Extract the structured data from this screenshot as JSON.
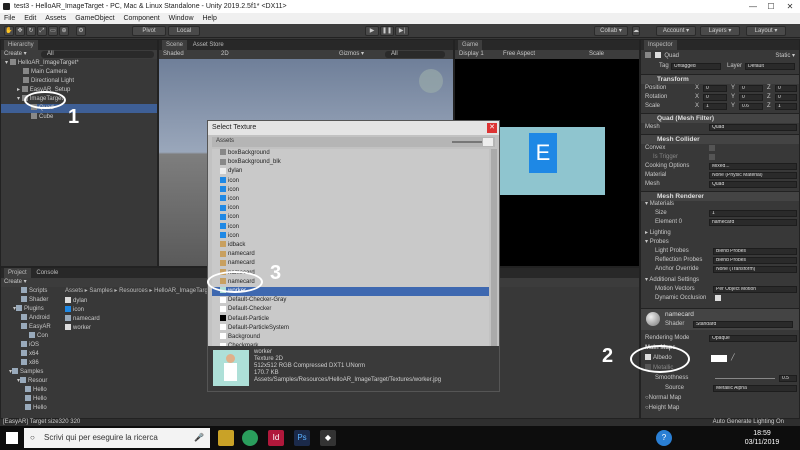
{
  "window": {
    "title": "test3 - HelloAR_ImageTarget - PC, Mac & Linux Standalone - Unity 2019.2.5f1* <DX11>",
    "controls": [
      "—",
      "☐",
      "✕"
    ]
  },
  "menu": [
    "File",
    "Edit",
    "Assets",
    "GameObject",
    "Component",
    "Window",
    "Help"
  ],
  "toolbar": {
    "pivot": "Pivot",
    "local": "Local",
    "collab": "Collab ▾",
    "account": "Account ▾",
    "layers": "Layers ▾",
    "layout": "Layout ▾"
  },
  "hierarchy": {
    "tab": "Hierarchy",
    "create": "Create ▾",
    "search": "All",
    "scene": "HelloAR_ImageTarget*",
    "items": [
      "Main Camera",
      "Directional Light",
      "EasyAR_Setup",
      "ImageTarget",
      "Quad",
      "Cube"
    ]
  },
  "scene": {
    "tab": "Scene",
    "asset_store": "Asset Store",
    "shaded": "Shaded",
    "mode": "2D",
    "gizmos": "Gizmos ▾",
    "search": "All"
  },
  "game": {
    "tab": "Game",
    "display": "Display 1",
    "aspect": "Free Aspect",
    "scale": "Scale",
    "maximize": "Maximize On Play"
  },
  "inspector": {
    "tab": "Inspector",
    "object_name": "Quad",
    "static": "Static ▾",
    "tag_label": "Tag",
    "tag": "Untagged",
    "layer_label": "Layer",
    "layer": "Default",
    "transform": {
      "title": "Transform",
      "position_label": "Position",
      "rotation_label": "Rotation",
      "scale_label": "Scale",
      "position": [
        "0",
        "0",
        "0"
      ],
      "rotation": [
        "0",
        "0",
        "0"
      ],
      "scale": [
        "1",
        "0.6",
        "1"
      ]
    },
    "mesh_filter": {
      "title": "Quad (Mesh Filter)",
      "mesh_label": "Mesh",
      "mesh": "Quad"
    },
    "mesh_collider": {
      "title": "Mesh Collider",
      "convex": "Convex",
      "is_trigger": "Is Trigger",
      "cooking_label": "Cooking Options",
      "cooking": "Mixed...",
      "material_label": "Material",
      "material": "None (Physic Material)",
      "mesh_label": "Mesh",
      "mesh": "Quad"
    },
    "mesh_renderer": {
      "title": "Mesh Renderer",
      "materials": "Materials",
      "size_label": "Size",
      "size": "1",
      "element0_label": "Element 0",
      "element0": "namecard",
      "lighting": "Lighting",
      "probes": "Probes",
      "light_probes_label": "Light Probes",
      "light_probes": "Blend Probes",
      "reflection_label": "Reflection Probes",
      "reflection": "Blend Probes",
      "anchor_label": "Anchor Override",
      "anchor": "None (Transform)",
      "additional": "Additional Settings",
      "motion_label": "Motion Vectors",
      "motion": "Per Object Motion",
      "occlusion_label": "Dynamic Occlusion"
    },
    "material": {
      "name": "namecard",
      "shader_label": "Shader",
      "shader": "Standard",
      "rendering_label": "Rendering Mode",
      "rendering": "Opaque",
      "main_maps": "Main Maps",
      "albedo": "Albedo",
      "metallic": "Metallic",
      "smoothness_label": "Smoothness",
      "smoothness": "0.5",
      "source_label": "Source",
      "source": "Metallic Alpha",
      "normal_map": "Normal Map",
      "height_map": "Height Map"
    }
  },
  "project": {
    "tabs": [
      "Project",
      "Console"
    ],
    "create": "Create ▾",
    "breadcrumb": [
      "Assets",
      "Samples",
      "Resources",
      "HelloAR_ImageTarget"
    ],
    "tree": [
      "Scripts",
      "Shader",
      "Plugins",
      "Android",
      "EasyAR",
      "Con",
      "iOS",
      "x64",
      "x86",
      "Samples",
      "Resour",
      "Hello",
      "Hello",
      "Hello",
      "M",
      "Te"
    ],
    "assets": [
      "dylan",
      "icon",
      "namecard",
      "worker"
    ]
  },
  "dialog": {
    "title": "Select Texture",
    "close": "✕",
    "tab": "Assets",
    "items": [
      {
        "name": "boxBackground",
        "icon": "grey-icon"
      },
      {
        "name": "boxBackground_blk",
        "icon": "grey-icon"
      },
      {
        "name": "dylan",
        "icon": "face-icon"
      },
      {
        "name": "icon",
        "icon": "e-icon"
      },
      {
        "name": "icon",
        "icon": "e-icon"
      },
      {
        "name": "icon",
        "icon": "e-icon"
      },
      {
        "name": "icon",
        "icon": "e-icon"
      },
      {
        "name": "icon",
        "icon": "e-icon"
      },
      {
        "name": "icon",
        "icon": "e-icon"
      },
      {
        "name": "icon",
        "icon": "e-icon"
      },
      {
        "name": "idback",
        "icon": "card-icon"
      },
      {
        "name": "namecard",
        "icon": "card-icon"
      },
      {
        "name": "namecard",
        "icon": "card-icon"
      },
      {
        "name": "namecard",
        "icon": "card-icon"
      },
      {
        "name": "namecard",
        "icon": "card-icon"
      },
      {
        "name": "worker",
        "icon": "worker-icon"
      },
      {
        "name": "Default-Checker-Gray",
        "icon": "white-icon"
      },
      {
        "name": "Default-Checker",
        "icon": "white-icon"
      },
      {
        "name": "Default-Particle",
        "icon": "dot-icon"
      },
      {
        "name": "Default-ParticleSystem",
        "icon": "white-icon"
      },
      {
        "name": "Background",
        "icon": "white-icon"
      },
      {
        "name": "Checkmark",
        "icon": "check-icon"
      },
      {
        "name": "DropdownArrow",
        "icon": "arrow-icon"
      }
    ],
    "selected_index": 15,
    "preview": {
      "name": "worker",
      "type": "Texture 2D",
      "info": "512x512  RGB Compressed DXT1 UNorm",
      "size": "170.7 KB",
      "path": "Assets/Samples/Resources/HelloAR_ImageTarget/Textures/worker.jpg"
    }
  },
  "status_bar": {
    "message": "[EasyAR] Target size320 320",
    "right": "Auto Generate Lighting On"
  },
  "annotations": [
    "1",
    "2",
    "3"
  ],
  "taskbar": {
    "search_placeholder": "Scrivi qui per eseguire la ricerca",
    "time": "18:59",
    "date": "03/11/2019",
    "help": "?"
  },
  "colors": {
    "accent": "#1e88e5",
    "selection": "#3e68b0",
    "panel": "#383838"
  }
}
